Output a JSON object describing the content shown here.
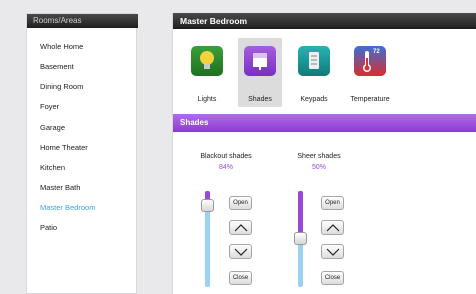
{
  "sidebar": {
    "title": "Rooms/Areas",
    "items": [
      {
        "label": "Whole Home"
      },
      {
        "label": "Basement"
      },
      {
        "label": "Dining Room"
      },
      {
        "label": "Foyer"
      },
      {
        "label": "Garage"
      },
      {
        "label": "Home Theater"
      },
      {
        "label": "Kitchen"
      },
      {
        "label": "Master Bath"
      },
      {
        "label": "Master Bedroom",
        "active": true
      },
      {
        "label": "Patio"
      }
    ]
  },
  "main": {
    "title": "Master Bedroom",
    "categories": [
      {
        "label": "Lights",
        "icon": "light-bulb-icon",
        "color": "#2e8b2e"
      },
      {
        "label": "Shades",
        "icon": "shade-window-icon",
        "color": "#8a3bd1",
        "selected": true
      },
      {
        "label": "Keypads",
        "icon": "keypad-icon",
        "color": "#1a9a9a"
      },
      {
        "label": "Temperature",
        "icon": "thermometer-icon",
        "color": "#d92c2c",
        "badge": "72"
      }
    ],
    "section": "Shades",
    "shades": [
      {
        "name": "Blackout shades",
        "percent": "84%",
        "open_label": "Open",
        "close_label": "Close",
        "level": 0.16
      },
      {
        "name": "Sheer shades",
        "percent": "50%",
        "open_label": "Open",
        "close_label": "Close",
        "level": 0.5
      }
    ]
  },
  "colors": {
    "accent_purple": "#9a48d6",
    "active_blue": "#3aa7e0",
    "track_blue": "#9bd2f3"
  }
}
